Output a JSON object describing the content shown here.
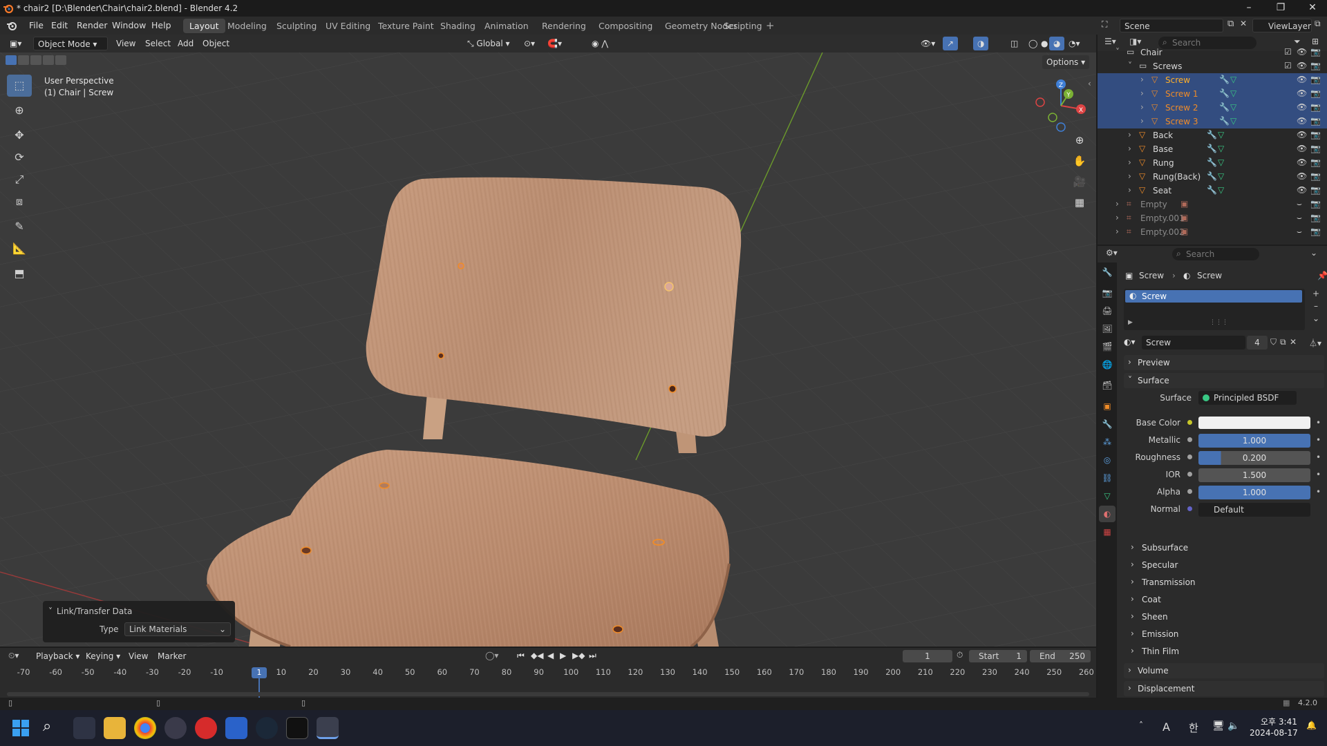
{
  "title": {
    "text": "* chair2 [D:\\Blender\\Chair\\chair2.blend] - Blender 4.2"
  },
  "menu": {
    "items": [
      "File",
      "Edit",
      "Render",
      "Window",
      "Help"
    ],
    "workspaces": [
      "Layout",
      "Modeling",
      "Sculpting",
      "UV Editing",
      "Texture Paint",
      "Shading",
      "Animation",
      "Rendering",
      "Compositing",
      "Geometry Nodes",
      "Scripting"
    ],
    "active_workspace": "Layout",
    "scene": "Scene",
    "view_layer": "ViewLayer"
  },
  "viewport_header": {
    "mode": "Object Mode",
    "view": "View",
    "select": "Select",
    "add": "Add",
    "object": "Object",
    "orientation": "Global",
    "options": "Options"
  },
  "viewport": {
    "perspective": "User Perspective",
    "object_info": "(1) Chair | Screw",
    "gizmo": {
      "x": "X",
      "y": "Y",
      "z": "Z"
    }
  },
  "link_transfer": {
    "title": "Link/Transfer Data",
    "type_label": "Type",
    "type_value": "Link Materials"
  },
  "outliner": {
    "search_placeholder": "Search",
    "rows": [
      {
        "label": "Chair",
        "depth": 3,
        "icon": "collection-icon",
        "selected": false,
        "color": "#d8d8d8",
        "chev": "˅",
        "mods": false
      },
      {
        "label": "Screws",
        "depth": 4,
        "icon": "collection-icon",
        "selected": false,
        "color": "#d8d8d8",
        "chev": "˅",
        "mods": false
      },
      {
        "label": "Screw",
        "depth": 5,
        "icon": "mesh-object-icon",
        "selected": true,
        "color": "#ffaf29",
        "chev": "›",
        "mods": true
      },
      {
        "label": "Screw 1",
        "depth": 5,
        "icon": "mesh-object-icon",
        "selected": true,
        "color": "#f08c28",
        "chev": "›",
        "mods": true
      },
      {
        "label": "Screw 2",
        "depth": 5,
        "icon": "mesh-object-icon",
        "selected": true,
        "color": "#f08c28",
        "chev": "›",
        "mods": true
      },
      {
        "label": "Screw 3",
        "depth": 5,
        "icon": "mesh-object-icon",
        "selected": true,
        "color": "#f08c28",
        "chev": "›",
        "mods": true
      },
      {
        "label": "Back",
        "depth": 4,
        "icon": "mesh-object-icon",
        "selected": false,
        "color": "#d8d8d8",
        "chev": "›",
        "mods": true
      },
      {
        "label": "Base",
        "depth": 4,
        "icon": "mesh-object-icon",
        "selected": false,
        "color": "#d8d8d8",
        "chev": "›",
        "mods": true
      },
      {
        "label": "Rung",
        "depth": 4,
        "icon": "mesh-object-icon",
        "selected": false,
        "color": "#d8d8d8",
        "chev": "›",
        "mods": true
      },
      {
        "label": "Rung(Back)",
        "depth": 4,
        "icon": "mesh-object-icon",
        "selected": false,
        "color": "#d8d8d8",
        "chev": "›",
        "mods": true
      },
      {
        "label": "Seat",
        "depth": 4,
        "icon": "mesh-object-icon",
        "selected": false,
        "color": "#d8d8d8",
        "chev": "›",
        "mods": true
      },
      {
        "label": "Empty",
        "depth": 3,
        "icon": "empty-icon",
        "selected": false,
        "color": "#8a8a8a",
        "chev": "›",
        "mods": false
      },
      {
        "label": "Empty.001",
        "depth": 3,
        "icon": "empty-icon",
        "selected": false,
        "color": "#8a8a8a",
        "chev": "›",
        "mods": false
      },
      {
        "label": "Empty.002",
        "depth": 3,
        "icon": "empty-icon",
        "selected": false,
        "color": "#8a8a8a",
        "chev": "›",
        "mods": false
      }
    ]
  },
  "properties": {
    "search_placeholder": "Search",
    "breadcrumb_object": "Screw",
    "breadcrumb_material": "Screw",
    "slot_name": "Screw",
    "material_name": "Screw",
    "user_count": "4",
    "preview": "Preview",
    "surface_panel": "Surface",
    "surface_label": "Surface",
    "surface_value": "Principled BSDF",
    "fields": [
      {
        "label": "Base Color",
        "value": "",
        "kind": "color"
      },
      {
        "label": "Metallic",
        "value": "1.000",
        "kind": "full"
      },
      {
        "label": "Roughness",
        "value": "0.200",
        "kind": "partial",
        "fill": 0.2
      },
      {
        "label": "IOR",
        "value": "1.500",
        "kind": "plain"
      },
      {
        "label": "Alpha",
        "value": "1.000",
        "kind": "full"
      },
      {
        "label": "Normal",
        "value": "Default",
        "kind": "dark"
      }
    ],
    "subpanels": [
      "Subsurface",
      "Specular",
      "Transmission",
      "Coat",
      "Sheen",
      "Emission",
      "Thin Film"
    ],
    "volume": "Volume",
    "displacement": "Displacement"
  },
  "timeline": {
    "playback": "Playback",
    "keying": "Keying",
    "view": "View",
    "marker": "Marker",
    "current_frame": "1",
    "start_label": "Start",
    "start_value": "1",
    "end_label": "End",
    "end_value": "250",
    "ticks": [
      "-70",
      "-60",
      "-50",
      "-40",
      "-30",
      "-20",
      "-10",
      "1",
      "10",
      "20",
      "30",
      "40",
      "50",
      "60",
      "70",
      "80",
      "90",
      "100",
      "110",
      "120",
      "130",
      "140",
      "150",
      "160",
      "170",
      "180",
      "190",
      "200",
      "210",
      "220",
      "230",
      "240",
      "250",
      "260"
    ]
  },
  "status": {
    "version": "4.2.0"
  },
  "taskbar": {
    "time": "오후 3:41",
    "date": "2024-08-17",
    "ime_a": "A",
    "ime_han": "한"
  }
}
